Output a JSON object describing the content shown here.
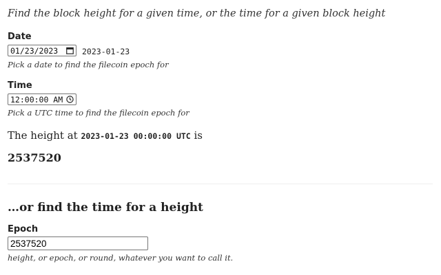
{
  "intro": "Find the block height for a given time, or the time for a given block height",
  "date": {
    "label": "Date",
    "input_value": "01/23/2023",
    "echo": "2023-01-23",
    "hint": "Pick a date to find the filecoin epoch for"
  },
  "time": {
    "label": "Time",
    "input_value": "12:00:00 AM",
    "hint": "Pick a UTC time to find the filecoin epoch for"
  },
  "result": {
    "prefix": "The height at",
    "timestamp": "2023-01-23 00:00:00 UTC",
    "suffix": "is",
    "height": "2537520"
  },
  "reverse": {
    "heading": "…or find the time for a height",
    "label": "Epoch",
    "input_value": "2537520",
    "hint": "height, or epoch, or round, whatever you want to call it."
  },
  "icons": {
    "date_picker": "calendar-icon",
    "time_picker": "clock-icon"
  }
}
